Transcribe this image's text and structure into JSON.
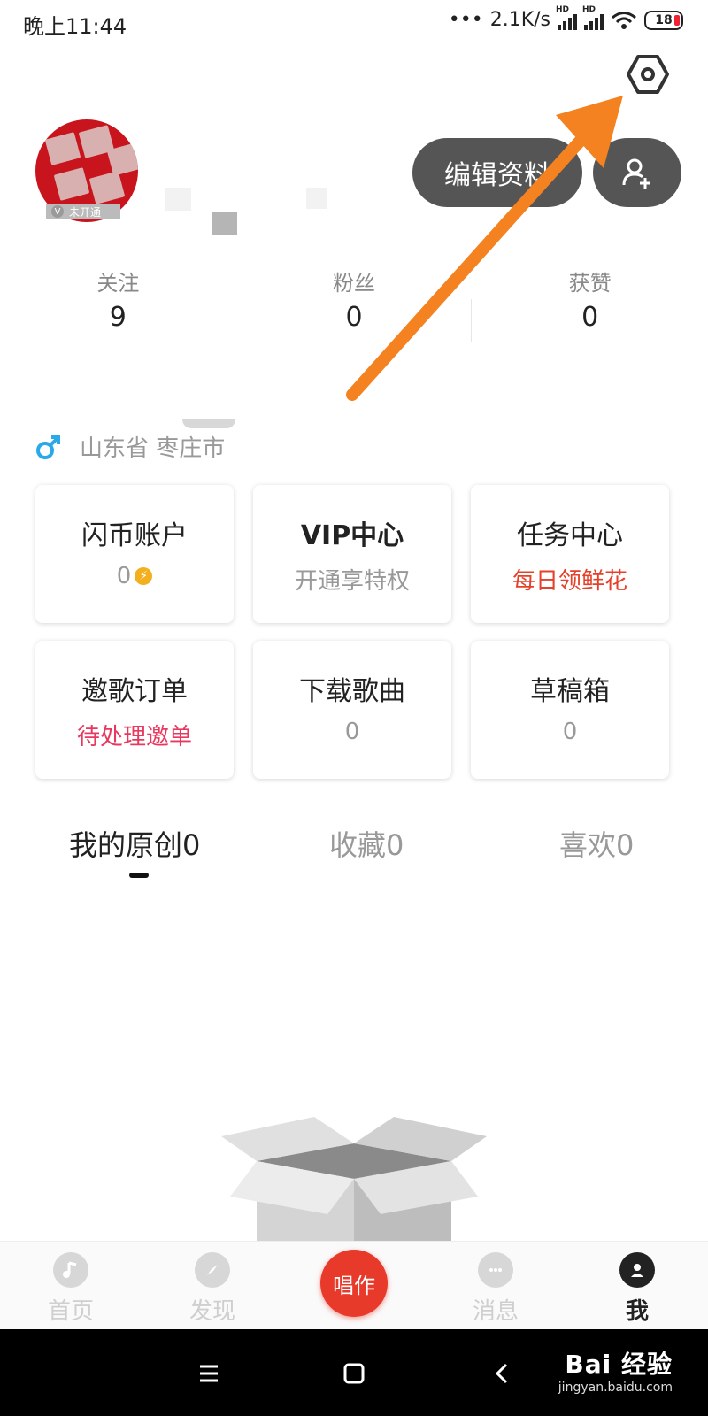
{
  "status_bar": {
    "time": "晚上11:44",
    "network_speed": "2.1K/s",
    "sim_tag": "HD",
    "battery": "18"
  },
  "profile": {
    "vip_tag": "未开通",
    "edit_button": "编辑资料",
    "stats": [
      {
        "label": "关注",
        "value": "9"
      },
      {
        "label": "粉丝",
        "value": "0"
      },
      {
        "label": "获赞",
        "value": "0"
      }
    ],
    "location": "山东省 枣庄市",
    "gender_icon": "male-icon"
  },
  "cards": [
    {
      "title": "闪币账户",
      "sub": "0",
      "sub_style": "gray",
      "icon": "coin-icon"
    },
    {
      "title": "VIP中心",
      "sub": "开通享特权",
      "sub_style": "gray"
    },
    {
      "title": "任务中心",
      "sub": "每日领鲜花",
      "sub_style": "red"
    },
    {
      "title": "邀歌订单",
      "sub": "待处理邀单",
      "sub_style": "pink"
    },
    {
      "title": "下载歌曲",
      "sub": "0",
      "sub_style": "gray"
    },
    {
      "title": "草稿箱",
      "sub": "0",
      "sub_style": "gray"
    }
  ],
  "tabs": [
    {
      "label": "我的原创",
      "count": "0",
      "active": true
    },
    {
      "label": "收藏",
      "count": "0",
      "active": false
    },
    {
      "label": "喜欢",
      "count": "0",
      "active": false
    }
  ],
  "bottom_nav": {
    "items": [
      {
        "label": "首页",
        "icon": "music-note-icon"
      },
      {
        "label": "发现",
        "icon": "compass-icon"
      },
      {
        "label": "消息",
        "icon": "chat-icon"
      },
      {
        "label": "我",
        "icon": "person-icon",
        "active": true
      }
    ],
    "center_button": "唱作"
  },
  "watermark": {
    "brand": "Bai 经验",
    "url": "jingyan.baidu.com"
  },
  "colors": {
    "accent_red": "#e83a2a",
    "task_red": "#e5402a",
    "invite_pink": "#e8385f",
    "arrow_orange": "#f58220",
    "button_dark": "#555555"
  }
}
